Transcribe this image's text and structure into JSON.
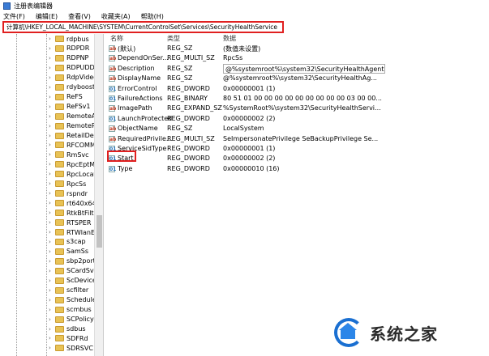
{
  "window": {
    "title": "注册表编辑器"
  },
  "menu": [
    "文件(F)",
    "编辑(E)",
    "查看(V)",
    "收藏夹(A)",
    "帮助(H)"
  ],
  "address": "计算机\\HKEY_LOCAL_MACHINE\\SYSTEM\\CurrentControlSet\\Services\\SecurityHealthService",
  "tree": {
    "items": [
      "rdpbus",
      "RDPDR",
      "RDPNP",
      "RDPUDD",
      "RdpVideo",
      "rdyboost",
      "ReFS",
      "ReFSv1",
      "RemoteAc",
      "RemoteRe",
      "RetailDem",
      "RFCOMM",
      "RmSvc",
      "RpcEptMa",
      "RpcLocato",
      "RpcSs",
      "rspndr",
      "rt640x64",
      "RtkBtFilter",
      "RTSPER",
      "RTWlanE",
      "s3cap",
      "SamSs",
      "sbp2port",
      "SCardSvr",
      "ScDeviceE",
      "scfilter",
      "Schedule",
      "scmbus",
      "SCPolicySv",
      "sdbus",
      "SDFRd",
      "SDRSVC"
    ]
  },
  "columns": {
    "name": "名称",
    "type": "类型",
    "data": "数据"
  },
  "values": [
    {
      "name": "(默认)",
      "type": "REG_SZ",
      "data": "(数值未设置)",
      "icon": "string"
    },
    {
      "name": "DependOnSer...",
      "type": "REG_MULTI_SZ",
      "data": "RpcSs",
      "icon": "string"
    },
    {
      "name": "Description",
      "type": "REG_SZ",
      "data": "@%systemroot%\\system32\\SecurityHealthAgent.dll,-1001",
      "icon": "string",
      "boxed": true
    },
    {
      "name": "DisplayName",
      "type": "REG_SZ",
      "data": "@%systemroot%\\system32\\SecurityHealthAg...",
      "icon": "string"
    },
    {
      "name": "ErrorControl",
      "type": "REG_DWORD",
      "data": "0x00000001 (1)",
      "icon": "binary"
    },
    {
      "name": "FailureActions",
      "type": "REG_BINARY",
      "data": "80 51 01 00 00 00 00 00 00 00 00 00 03 00 00...",
      "icon": "binary"
    },
    {
      "name": "ImagePath",
      "type": "REG_EXPAND_SZ",
      "data": "%SystemRoot%\\system32\\SecurityHealthServi...",
      "icon": "string"
    },
    {
      "name": "LaunchProtected",
      "type": "REG_DWORD",
      "data": "0x00000002 (2)",
      "icon": "binary"
    },
    {
      "name": "ObjectName",
      "type": "REG_SZ",
      "data": "LocalSystem",
      "icon": "string"
    },
    {
      "name": "RequiredPrivile...",
      "type": "REG_MULTI_SZ",
      "data": "SeImpersonatePrivilege SeBackupPrivilege Se...",
      "icon": "string"
    },
    {
      "name": "ServiceSidType",
      "type": "REG_DWORD",
      "data": "0x00000001 (1)",
      "icon": "binary"
    },
    {
      "name": "Start",
      "type": "REG_DWORD",
      "data": "0x00000002 (2)",
      "icon": "binary"
    },
    {
      "name": "Type",
      "type": "REG_DWORD",
      "data": "0x00000010 (16)",
      "icon": "binary"
    }
  ],
  "watermark": {
    "text": "系统之家"
  }
}
